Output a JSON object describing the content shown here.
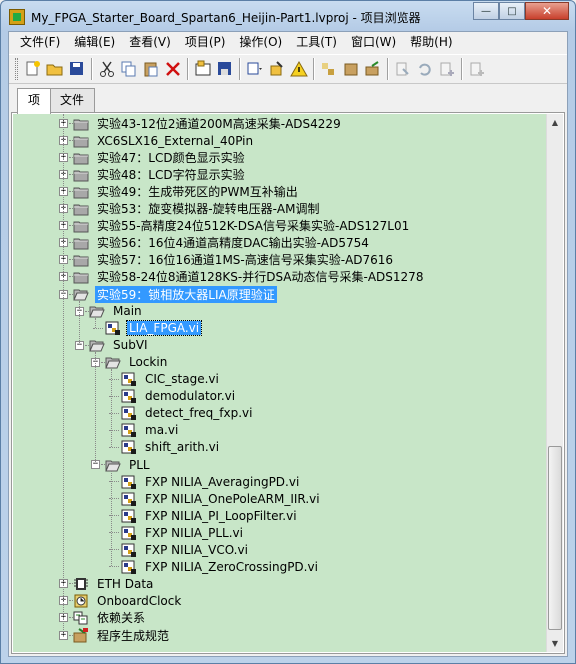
{
  "window": {
    "title": "My_FPGA_Starter_Board_Spartan6_Heijin-Part1.lvproj - 项目浏览器",
    "buttons": {
      "minimize": "—",
      "maximize": "□",
      "close": "✕"
    }
  },
  "menu": {
    "items": [
      "文件(F)",
      "编辑(E)",
      "查看(V)",
      "项目(P)",
      "操作(O)",
      "工具(T)",
      "窗口(W)",
      "帮助(H)"
    ]
  },
  "tabs": [
    {
      "label": "项",
      "active": true
    },
    {
      "label": "文件",
      "active": false
    }
  ],
  "tree": {
    "rows": [
      {
        "label": "实验43-12位2通道200M高速采集-ADS4229",
        "type": "folder",
        "level": 0,
        "expander": "+"
      },
      {
        "label": "XC6SLX16_External_40Pin",
        "type": "folder",
        "level": 0,
        "expander": "+"
      },
      {
        "label": "实验47：LCD颜色显示实验",
        "type": "folder",
        "level": 0,
        "expander": "+"
      },
      {
        "label": "实验48：LCD字符显示实验",
        "type": "folder",
        "level": 0,
        "expander": "+"
      },
      {
        "label": "实验49：生成带死区的PWM互补输出",
        "type": "folder",
        "level": 0,
        "expander": "+"
      },
      {
        "label": "实验53：旋变模拟器-旋转电压器-AM调制",
        "type": "folder",
        "level": 0,
        "expander": "+"
      },
      {
        "label": "实验55-高精度24位512K-DSA信号采集实验-ADS127L01",
        "type": "folder",
        "level": 0,
        "expander": "+"
      },
      {
        "label": "实验56：16位4通道高精度DAC输出实验-AD5754",
        "type": "folder",
        "level": 0,
        "expander": "+"
      },
      {
        "label": "实验57：16位16通道1MS-高速信号采集实验-AD7616",
        "type": "folder",
        "level": 0,
        "expander": "+"
      },
      {
        "label": "实验58-24位8通道128KS-并行DSA动态信号采集-ADS1278",
        "type": "folder",
        "level": 0,
        "expander": "+"
      },
      {
        "label": "实验59：锁相放大器LIA原理验证",
        "type": "folder-open",
        "level": 0,
        "expander": "−",
        "state": "selected"
      },
      {
        "label": "Main",
        "type": "folder-open",
        "level": 1,
        "expander": "−"
      },
      {
        "label": "LIA_FPGA.vi",
        "type": "vi",
        "level": 2,
        "state": "highlight"
      },
      {
        "label": "SubVI",
        "type": "folder-open",
        "level": 1,
        "expander": "−"
      },
      {
        "label": "Lockin",
        "type": "folder-open",
        "level": 2,
        "expander": "−"
      },
      {
        "label": "CIC_stage.vi",
        "type": "vi",
        "level": 3
      },
      {
        "label": "demodulator.vi",
        "type": "vi",
        "level": 3
      },
      {
        "label": "detect_freq_fxp.vi",
        "type": "vi",
        "level": 3
      },
      {
        "label": "ma.vi",
        "type": "vi",
        "level": 3
      },
      {
        "label": "shift_arith.vi",
        "type": "vi",
        "level": 3
      },
      {
        "label": "PLL",
        "type": "folder-open",
        "level": 2,
        "expander": "−"
      },
      {
        "label": "FXP NILIA_AveragingPD.vi",
        "type": "vi",
        "level": 3
      },
      {
        "label": "FXP NILIA_OnePoleARM_IIR.vi",
        "type": "vi",
        "level": 3
      },
      {
        "label": "FXP NILIA_PI_LoopFilter.vi",
        "type": "vi",
        "level": 3
      },
      {
        "label": "FXP NILIA_PLL.vi",
        "type": "vi",
        "level": 3
      },
      {
        "label": "FXP NILIA_VCO.vi",
        "type": "vi",
        "level": 3
      },
      {
        "label": "FXP NILIA_ZeroCrossingPD.vi",
        "type": "vi",
        "level": 3
      },
      {
        "label": "ETH Data",
        "type": "chip",
        "level": 0,
        "expander": "+"
      },
      {
        "label": "OnboardClock",
        "type": "clock",
        "level": 0,
        "expander": "+"
      },
      {
        "label": "依赖关系",
        "type": "deps",
        "level": 0,
        "expander": "+"
      },
      {
        "label": "程序生成规范",
        "type": "build",
        "level": 0,
        "expander": "+"
      }
    ]
  },
  "colors": {
    "tree_bg": "#c8e6c8",
    "selection": "#3399ff",
    "folder": "#9a9a9a"
  }
}
